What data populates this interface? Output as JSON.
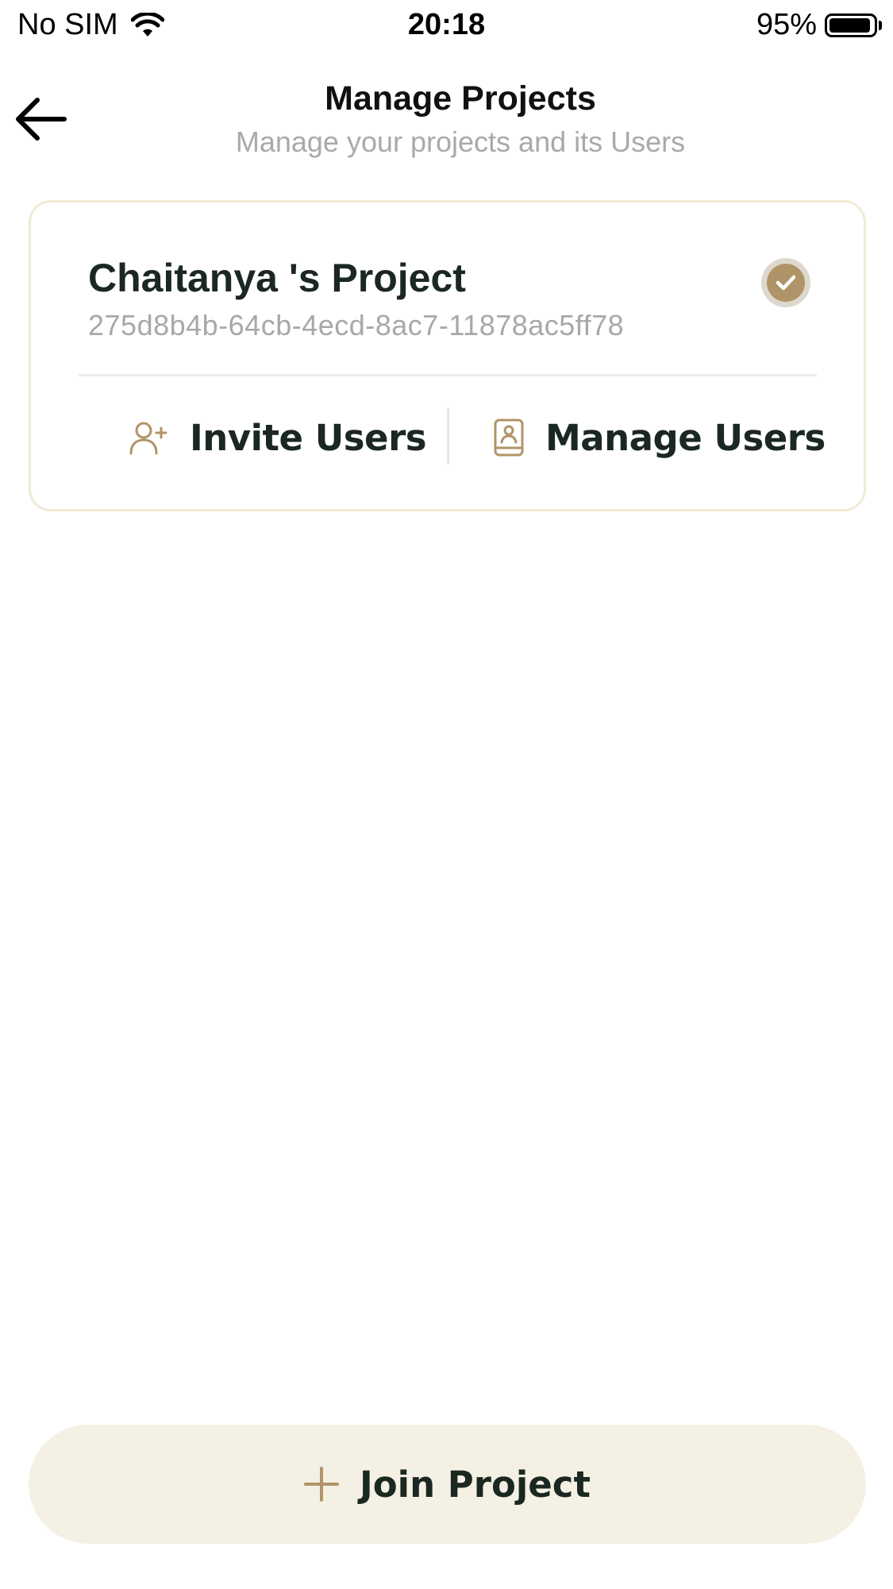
{
  "status_bar": {
    "carrier": "No SIM",
    "time": "20:18",
    "battery": "95%",
    "battery_level": 0.95,
    "wifi_icon": "wifi-icon",
    "battery_icon": "battery-icon"
  },
  "header": {
    "title": "Manage Projects",
    "subtitle": "Manage your projects and its Users",
    "back_icon": "arrow-left-icon"
  },
  "projects": [
    {
      "name": "Chaitanya 's Project",
      "id": "275d8b4b-64cb-4ecd-8ac7-11878ac5ff78",
      "selected": true,
      "actions": {
        "invite_label": "Invite Users",
        "invite_icon": "add-user-icon",
        "manage_label": "Manage Users",
        "manage_icon": "contact-book-icon"
      }
    }
  ],
  "footer": {
    "join_label": "Join Project",
    "join_icon": "plus-icon"
  },
  "colors": {
    "accent": "#b09467",
    "card_border": "#f1ead5",
    "join_bg": "#f4f0e4",
    "text_dark": "#1b2821",
    "text_muted": "#a8a8a8"
  }
}
